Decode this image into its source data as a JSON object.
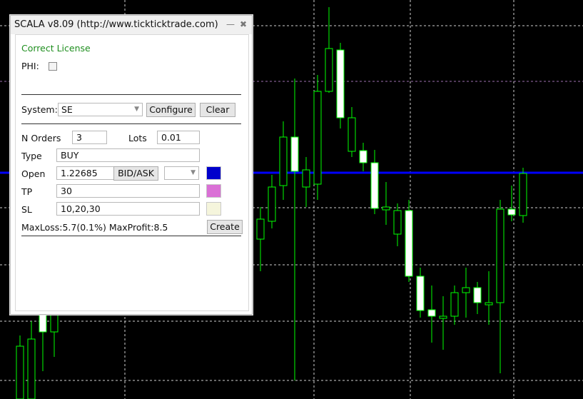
{
  "window": {
    "title": "SCALA v8.09 (http://www.tickticktrade.com)",
    "minimize_icon": "minimize-icon",
    "close_icon": "close-icon"
  },
  "license_status": "Correct License",
  "phi": {
    "label": "PHI:",
    "checked": false
  },
  "system": {
    "label": "System:",
    "value": "SE",
    "configure_label": "Configure",
    "clear_label": "Clear"
  },
  "orders": {
    "label": "N Orders",
    "value": "3"
  },
  "lots": {
    "label": "Lots",
    "value": "0.01"
  },
  "type": {
    "label": "Type",
    "value": "BUY"
  },
  "open": {
    "label": "Open",
    "value": "1.22685",
    "bidask_label": "BID/ASK",
    "dropdown_value": "",
    "color": "#0000cc"
  },
  "tp": {
    "label": "TP",
    "value": "30",
    "color": "#da70d6"
  },
  "sl": {
    "label": "SL",
    "value": "10,20,30",
    "color": "#f5f5dc"
  },
  "summary": "MaxLoss:5.7(0.1%) MaxProfit:8.5",
  "create_label": "Create",
  "chart": {
    "background": "#000000",
    "candle_color": "#00ff00",
    "level_line_color": "#0000ff"
  }
}
